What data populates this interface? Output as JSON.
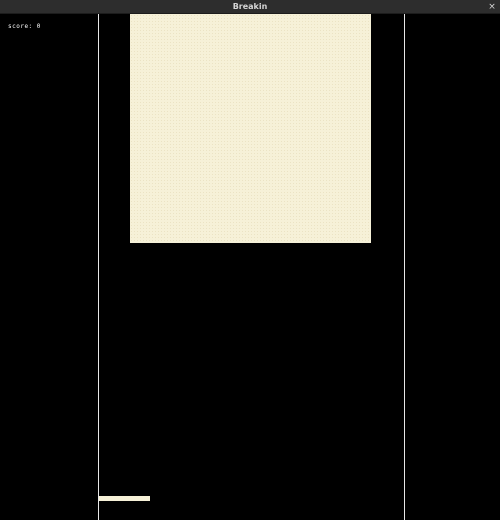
{
  "window": {
    "title": "Breakin"
  },
  "hud": {
    "score_text": "score: 0"
  },
  "colors": {
    "background": "#000000",
    "walls": "#e8e8e8",
    "bricks": "#f6f1d8",
    "paddle": "#f6f1d8",
    "titlebar": "#2d2d2d"
  },
  "icons": {
    "close": "close-icon"
  }
}
